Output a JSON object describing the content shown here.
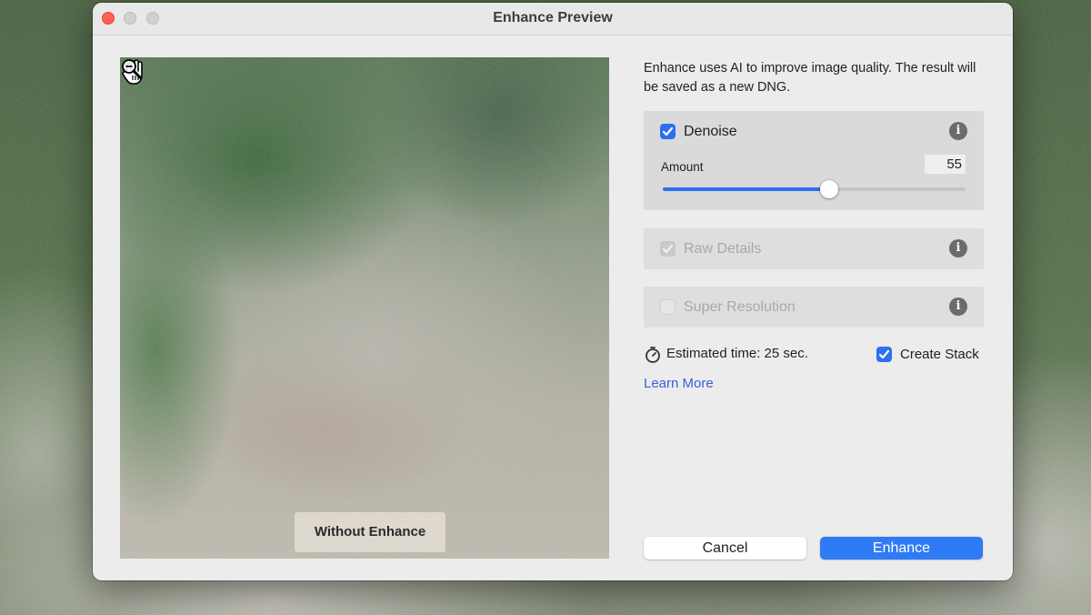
{
  "window": {
    "title": "Enhance Preview"
  },
  "preview": {
    "toggle_label": "Without Enhance"
  },
  "description": "Enhance uses AI to improve image quality. The result will be saved as a new DNG.",
  "options": {
    "denoise": {
      "label": "Denoise",
      "checked": true,
      "amount_label": "Amount",
      "amount_value": "55",
      "amount_fraction": 0.55
    },
    "raw_details": {
      "label": "Raw Details",
      "checked": true,
      "enabled": false
    },
    "super_resolution": {
      "label": "Super Resolution",
      "checked": false,
      "enabled": false
    }
  },
  "estimate": {
    "text": "Estimated time: 25 sec."
  },
  "create_stack": {
    "label": "Create Stack",
    "checked": true
  },
  "learn_more": "Learn More",
  "buttons": {
    "cancel": "Cancel",
    "enhance": "Enhance"
  },
  "colors": {
    "accent": "#2f6ff0",
    "close": "#ff5f57",
    "link": "#3a5fd8"
  },
  "icons": [
    "hand-cursor-icon",
    "zoom-out-icon",
    "info-icon",
    "timer-icon",
    "checkmark-icon"
  ]
}
